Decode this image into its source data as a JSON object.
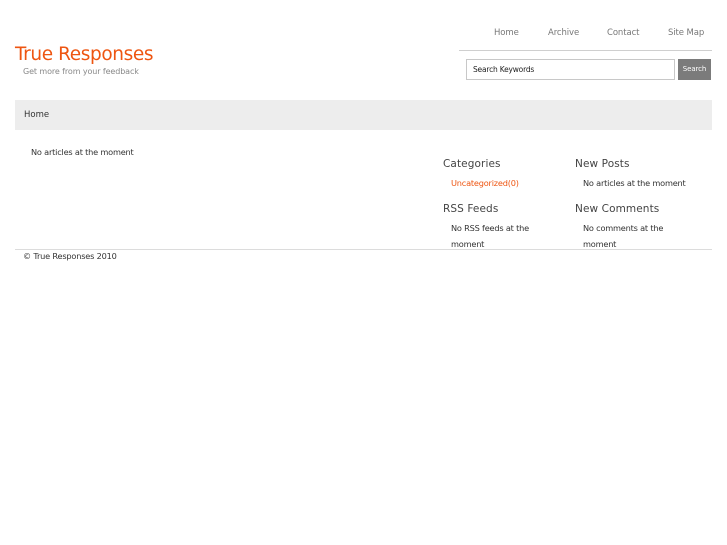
{
  "nav": {
    "items": [
      "Home",
      "Archive",
      "Contact",
      "Site Map"
    ]
  },
  "logo": {
    "title": "True Responses",
    "tagline": "Get more from your feedback"
  },
  "search": {
    "value": "Search Keywords",
    "button_label": "Search"
  },
  "breadcrumb": {
    "label": "Home"
  },
  "main": {
    "empty_message": "No articles at the moment"
  },
  "sidebar": {
    "categories": {
      "title": "Categories",
      "link": "Uncategorized(0)"
    },
    "new_posts": {
      "title": "New Posts",
      "text": "No articles at the moment"
    },
    "rss_feeds": {
      "title": "RSS Feeds",
      "text": "No RSS feeds at the moment"
    },
    "new_comments": {
      "title": "New Comments",
      "text": "No comments at the moment"
    }
  },
  "footer": {
    "text": "© True Responses 2010"
  },
  "colors": {
    "accent": "#ee5511",
    "button": "#7b7b7b",
    "breadcrumb_bg": "#ededed"
  }
}
